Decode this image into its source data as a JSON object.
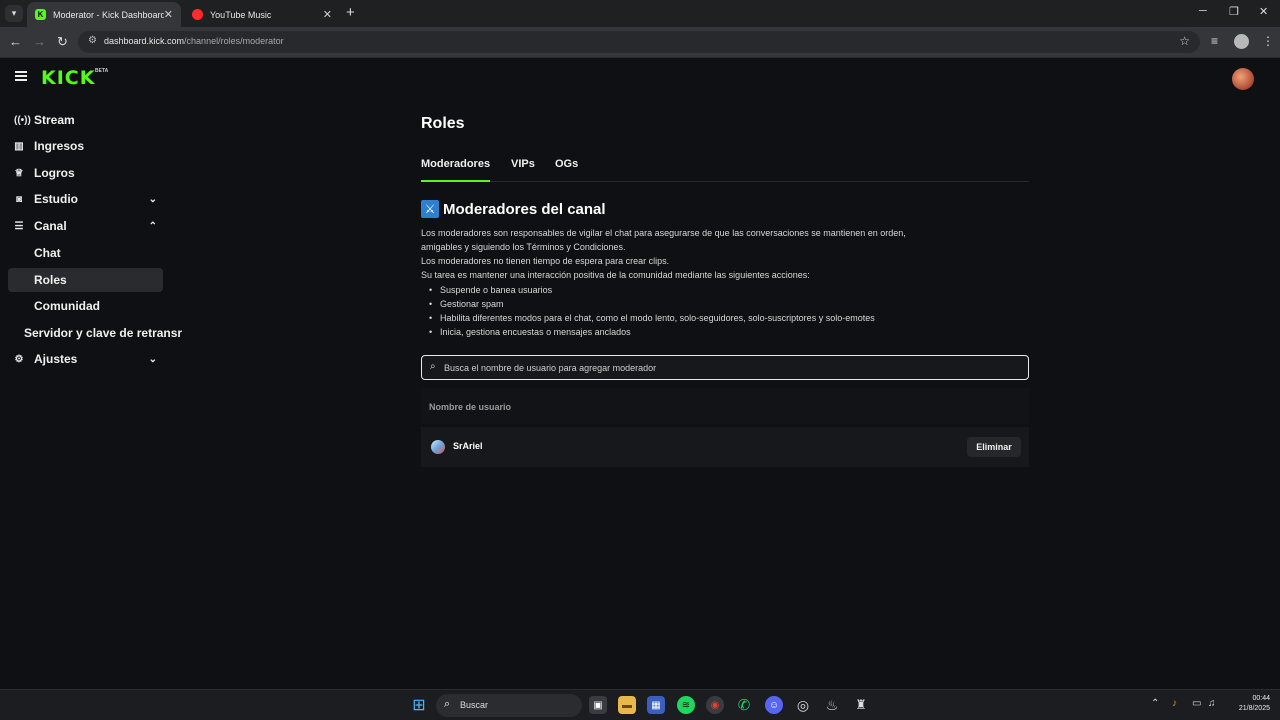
{
  "browser": {
    "tabs": [
      {
        "title": "Moderator - Kick Dashboard",
        "favicon": "K"
      },
      {
        "title": "YouTube Music"
      }
    ],
    "url_host": "dashboard.kick.com",
    "url_path": "/channel/roles/moderator"
  },
  "header": {
    "logo": "KICK",
    "logo_badge": "BETA"
  },
  "sidebar": {
    "items": [
      {
        "label": "Stream"
      },
      {
        "label": "Ingresos"
      },
      {
        "label": "Logros"
      },
      {
        "label": "Estudio"
      },
      {
        "label": "Canal"
      },
      {
        "label": "Chat"
      },
      {
        "label": "Roles"
      },
      {
        "label": "Comunidad"
      },
      {
        "label": "Servidor y clave de retransr"
      },
      {
        "label": "Ajustes"
      }
    ]
  },
  "main": {
    "title": "Roles",
    "tabs": [
      {
        "label": "Moderadores"
      },
      {
        "label": "VIPs"
      },
      {
        "label": "OGs"
      }
    ],
    "section_title": "Moderadores del canal",
    "description": [
      "Los moderadores son responsables de vigilar el chat para asegurarse de que las conversaciones se mantienen en orden,",
      "amigables y siguiendo los Términos y Condiciones.",
      "Los moderadores no tienen tiempo de espera para crear clips.",
      "Su tarea es mantener una interacción positiva de la comunidad mediante las siguientes acciones:"
    ],
    "bullets": [
      "Suspende o banea usuarios",
      "Gestionar spam",
      "Habilita diferentes modos para el chat, como el modo lento, solo-seguidores, solo-suscriptores y solo-emotes",
      "Inicia, gestiona encuestas o mensajes anclados"
    ],
    "search_placeholder": "Busca el nombre de usuario para agregar moderador",
    "table_header": "Nombre de usuario",
    "rows": [
      {
        "username": "SrAriel",
        "action": "Eliminar"
      }
    ]
  },
  "taskbar": {
    "search_label": "Buscar",
    "time": "00:44",
    "date": "21/8/2025"
  },
  "colors": {
    "accent": "#53fc18",
    "background": "#0f1013"
  }
}
